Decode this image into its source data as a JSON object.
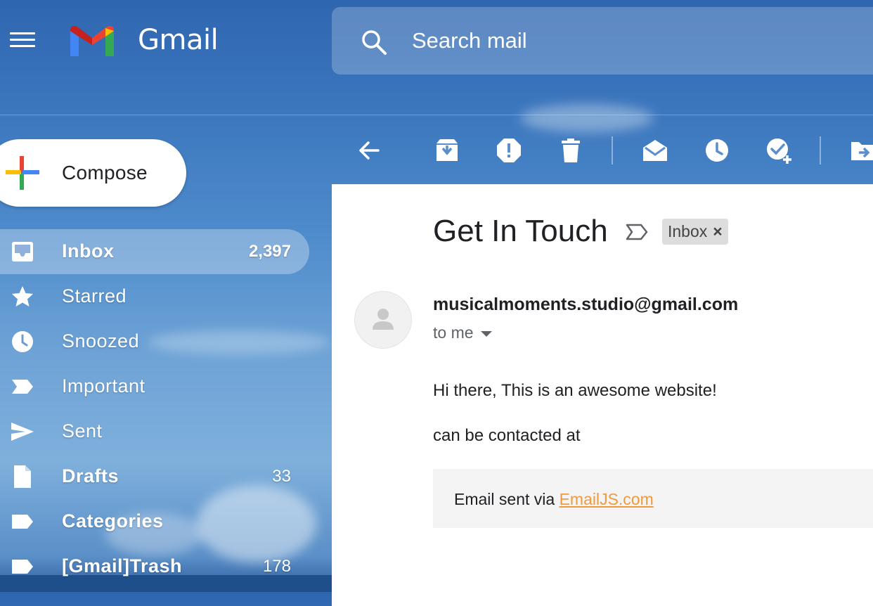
{
  "app": {
    "name": "Gmail"
  },
  "search": {
    "placeholder": "Search mail"
  },
  "compose": {
    "label": "Compose"
  },
  "sidebar": {
    "items": [
      {
        "label": "Inbox",
        "count": "2,397",
        "icon": "inbox-icon",
        "active": true
      },
      {
        "label": "Starred",
        "count": "",
        "icon": "star-icon"
      },
      {
        "label": "Snoozed",
        "count": "",
        "icon": "clock-icon"
      },
      {
        "label": "Important",
        "count": "",
        "icon": "important-icon"
      },
      {
        "label": "Sent",
        "count": "",
        "icon": "send-icon"
      },
      {
        "label": "Drafts",
        "count": "33",
        "icon": "draft-icon"
      },
      {
        "label": "Categories",
        "count": "",
        "icon": "label-icon"
      },
      {
        "label": "[Gmail]Trash",
        "count": "178",
        "icon": "label-icon"
      }
    ]
  },
  "toolbar": {
    "icons": [
      "back-arrow-icon",
      "archive-icon",
      "report-spam-icon",
      "delete-icon",
      "mark-unread-icon",
      "snooze-icon",
      "add-to-tasks-icon",
      "move-to-icon"
    ]
  },
  "message": {
    "subject": "Get In Touch",
    "label_chip": "Inbox",
    "label_remove": "×",
    "sender": "musicalmoments.studio@gmail.com",
    "recipient": "to me",
    "body_line1": "Hi there, This is an awesome website!",
    "body_line2": "can be contacted at",
    "footer_prefix": "Email sent via ",
    "footer_link": "EmailJS.com"
  },
  "colors": {
    "link": "#f09a3e",
    "panel_bg": "#ffffff",
    "theme_blue": "#3b76bd"
  }
}
